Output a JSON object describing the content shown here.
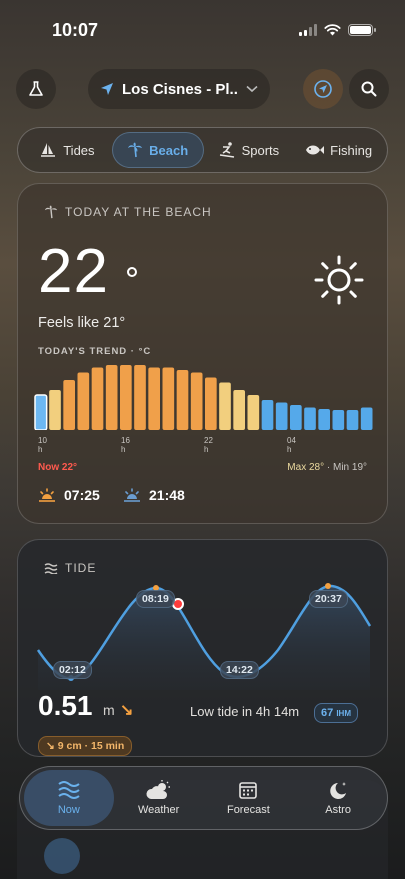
{
  "status": {
    "time": "10:07"
  },
  "header": {
    "location": "Los Cisnes - Pl..."
  },
  "tabs": [
    {
      "label": "Tides",
      "icon": "sailboat-icon"
    },
    {
      "label": "Beach",
      "icon": "palm-tree-icon",
      "active": true
    },
    {
      "label": "Sports",
      "icon": "skier-icon"
    },
    {
      "label": "Fishing",
      "icon": "fish-icon"
    }
  ],
  "beach": {
    "title": "TODAY AT THE BEACH",
    "temperature": "22",
    "feels_like": "Feels like 21°",
    "trend_label": "TODAY'S TREND · °C",
    "x_labels": [
      {
        "v": "10",
        "u": "h"
      },
      {
        "v": "16",
        "u": "h"
      },
      {
        "v": "22",
        "u": "h"
      },
      {
        "v": "04",
        "u": "h"
      }
    ],
    "now_label": "Now 22°",
    "max_label": "Max 28°",
    "min_label": "Min 19°",
    "sunrise": "07:25",
    "sunset": "21:48"
  },
  "chart_data": {
    "type": "bar",
    "title": "TODAY'S TREND · °C",
    "categories": [
      "10h",
      "11h",
      "12h",
      "13h",
      "14h",
      "15h",
      "16h",
      "17h",
      "18h",
      "19h",
      "20h",
      "21h",
      "22h",
      "23h",
      "00h",
      "01h",
      "02h",
      "03h",
      "04h",
      "05h",
      "06h",
      "07h",
      "08h",
      "09h"
    ],
    "values": [
      22,
      23,
      25,
      26.5,
      27.5,
      28,
      28,
      28,
      27.5,
      27.5,
      27,
      26.5,
      25.5,
      24.5,
      23,
      22,
      21,
      20.5,
      20,
      19.5,
      19.2,
      19,
      19,
      19.5
    ],
    "colors_by_index": {
      "current": "#6db8f2",
      "warm": "#f0a04a",
      "light": "#f2cf7e",
      "cool": "#55a9ea"
    },
    "ylim": [
      15,
      29
    ]
  },
  "tide": {
    "title": "TIDE",
    "times": [
      "02:12",
      "08:19",
      "14:22",
      "20:37"
    ],
    "value": "0.51",
    "unit": "m",
    "status": "Low tide in 4h 14m",
    "coef": "67",
    "coef_unit": "IHM",
    "rate": "9 cm · 15 min"
  },
  "nav": [
    {
      "label": "Now",
      "icon": "waves-icon",
      "active": true
    },
    {
      "label": "Weather",
      "icon": "cloud-sun-icon"
    },
    {
      "label": "Forecast",
      "icon": "calendar-icon"
    },
    {
      "label": "Astro",
      "icon": "moon-star-icon"
    }
  ]
}
